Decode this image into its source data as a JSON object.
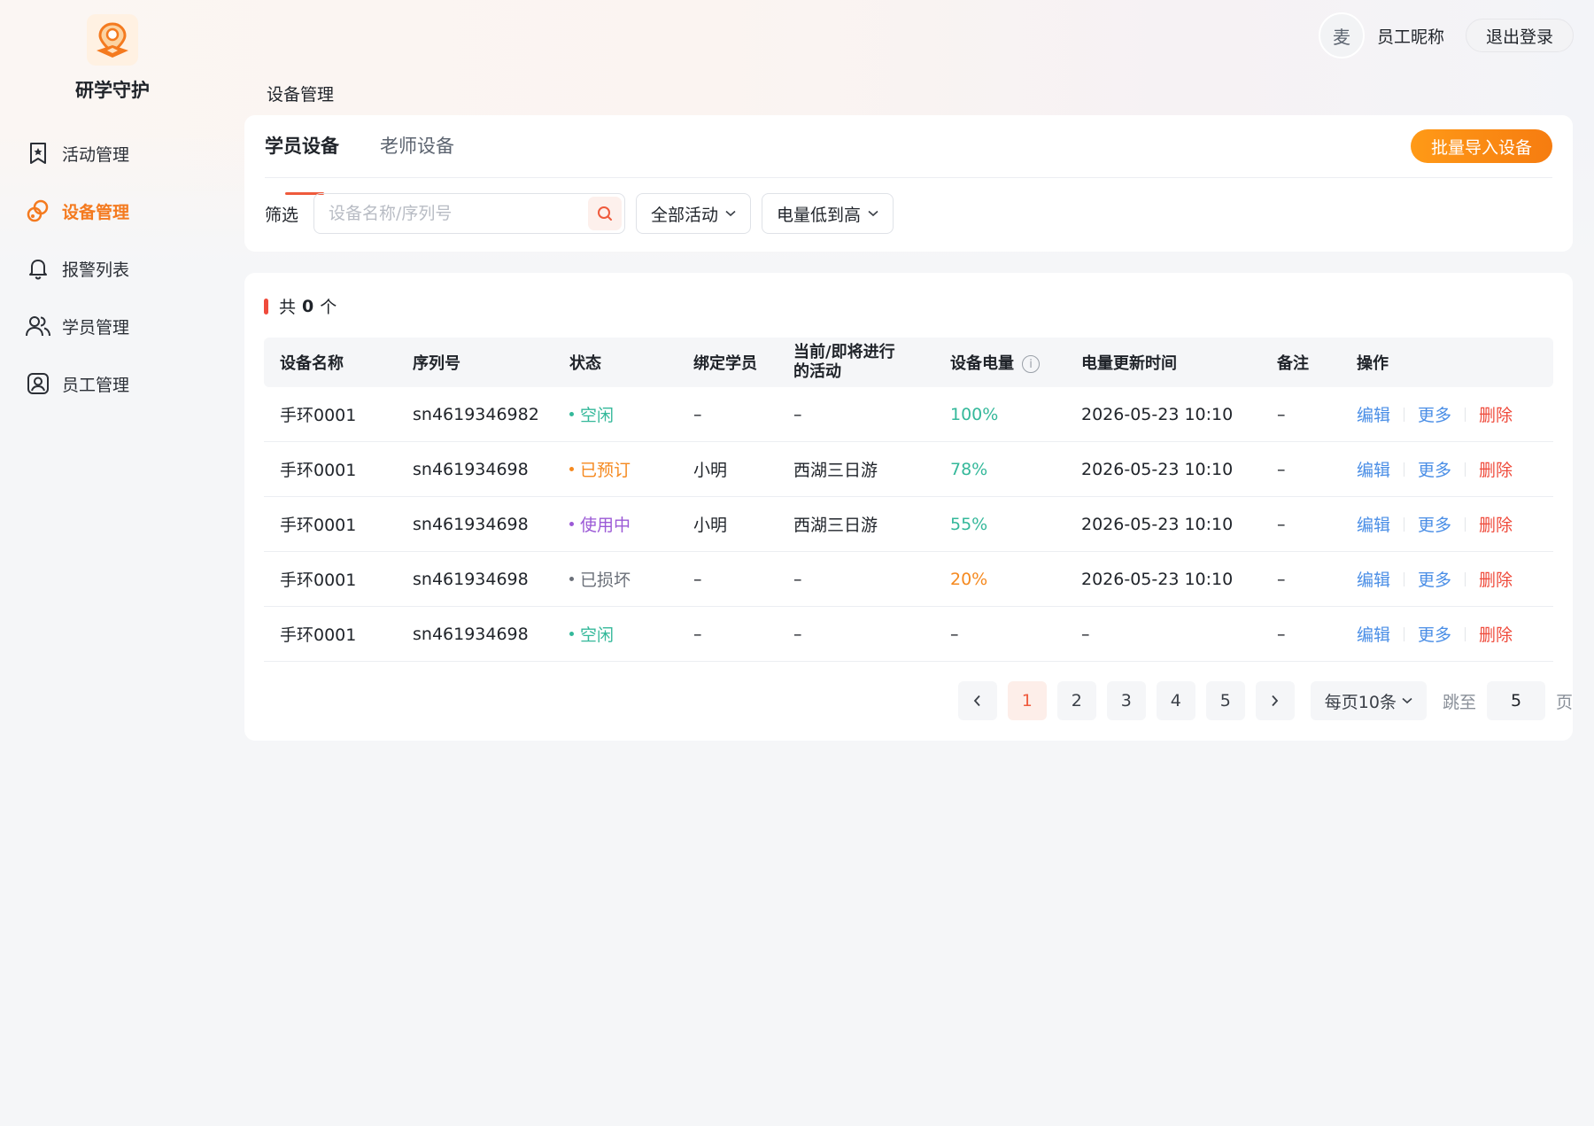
{
  "app": {
    "name": "研学守护"
  },
  "sidebar": {
    "items": [
      {
        "label": "活动管理",
        "icon": "bookmark-star-icon",
        "active": false
      },
      {
        "label": "设备管理",
        "icon": "link-device-icon",
        "active": true
      },
      {
        "label": "报警列表",
        "icon": "bell-icon",
        "active": false
      },
      {
        "label": "学员管理",
        "icon": "users-icon",
        "active": false
      },
      {
        "label": "员工管理",
        "icon": "user-card-icon",
        "active": false
      }
    ]
  },
  "header": {
    "avatar_text": "麦",
    "nickname": "员工昵称",
    "logout_label": "退出登录"
  },
  "breadcrumb": "设备管理",
  "tabs": [
    {
      "label": "学员设备",
      "active": true
    },
    {
      "label": "老师设备",
      "active": false
    }
  ],
  "import_button": "批量导入设备",
  "filter": {
    "label": "筛选",
    "search_placeholder": "设备名称/序列号",
    "activity_select": "全部活动",
    "sort_select": "电量低到高"
  },
  "summary": {
    "prefix": "共",
    "count": "0",
    "suffix": "个"
  },
  "table": {
    "columns": [
      "设备名称",
      "序列号",
      "状态",
      "绑定学员",
      "当前/即将进行的活动",
      "设备电量",
      "电量更新时间",
      "备注",
      "操作"
    ],
    "rows": [
      {
        "name": "手环0001",
        "serial": "sn4619346982",
        "status": "空闲",
        "status_color": "#34b89a",
        "student": "–",
        "activity": "–",
        "battery": "100%",
        "battery_color": "#34b89a",
        "updated": "2026-05-23 10:10",
        "note": "–"
      },
      {
        "name": "手环0001",
        "serial": "sn461934698",
        "status": "已预订",
        "status_color": "#f5891f",
        "student": "小明",
        "activity": "西湖三日游",
        "battery": "78%",
        "battery_color": "#34b89a",
        "updated": "2026-05-23 10:10",
        "note": "–"
      },
      {
        "name": "手环0001",
        "serial": "sn461934698",
        "status": "使用中",
        "status_color": "#9b59d6",
        "student": "小明",
        "activity": "西湖三日游",
        "battery": "55%",
        "battery_color": "#34b89a",
        "updated": "2026-05-23 10:10",
        "note": "–"
      },
      {
        "name": "手环0001",
        "serial": "sn461934698",
        "status": "已损坏",
        "status_color": "#6b7079",
        "student": "–",
        "activity": "–",
        "battery": "20%",
        "battery_color": "#f5891f",
        "updated": "2026-05-23 10:10",
        "note": "–"
      },
      {
        "name": "手环0001",
        "serial": "sn461934698",
        "status": "空闲",
        "status_color": "#34b89a",
        "student": "–",
        "activity": "–",
        "battery": "–",
        "battery_color": "#1f2329",
        "updated": "–",
        "note": "–"
      }
    ],
    "ops": {
      "edit": "编辑",
      "more": "更多",
      "delete": "删除",
      "edit_color": "#4a8ee6",
      "delete_color": "#ef4b3c"
    }
  },
  "pagination": {
    "pages": [
      "1",
      "2",
      "3",
      "4",
      "5"
    ],
    "current": "1",
    "page_size": "每页10条",
    "jump_label": "跳至",
    "jump_value": "5",
    "page_unit": "页"
  },
  "colors": {
    "accent": "#f47a1f",
    "danger": "#ef4b3c",
    "link": "#4a8ee6"
  }
}
